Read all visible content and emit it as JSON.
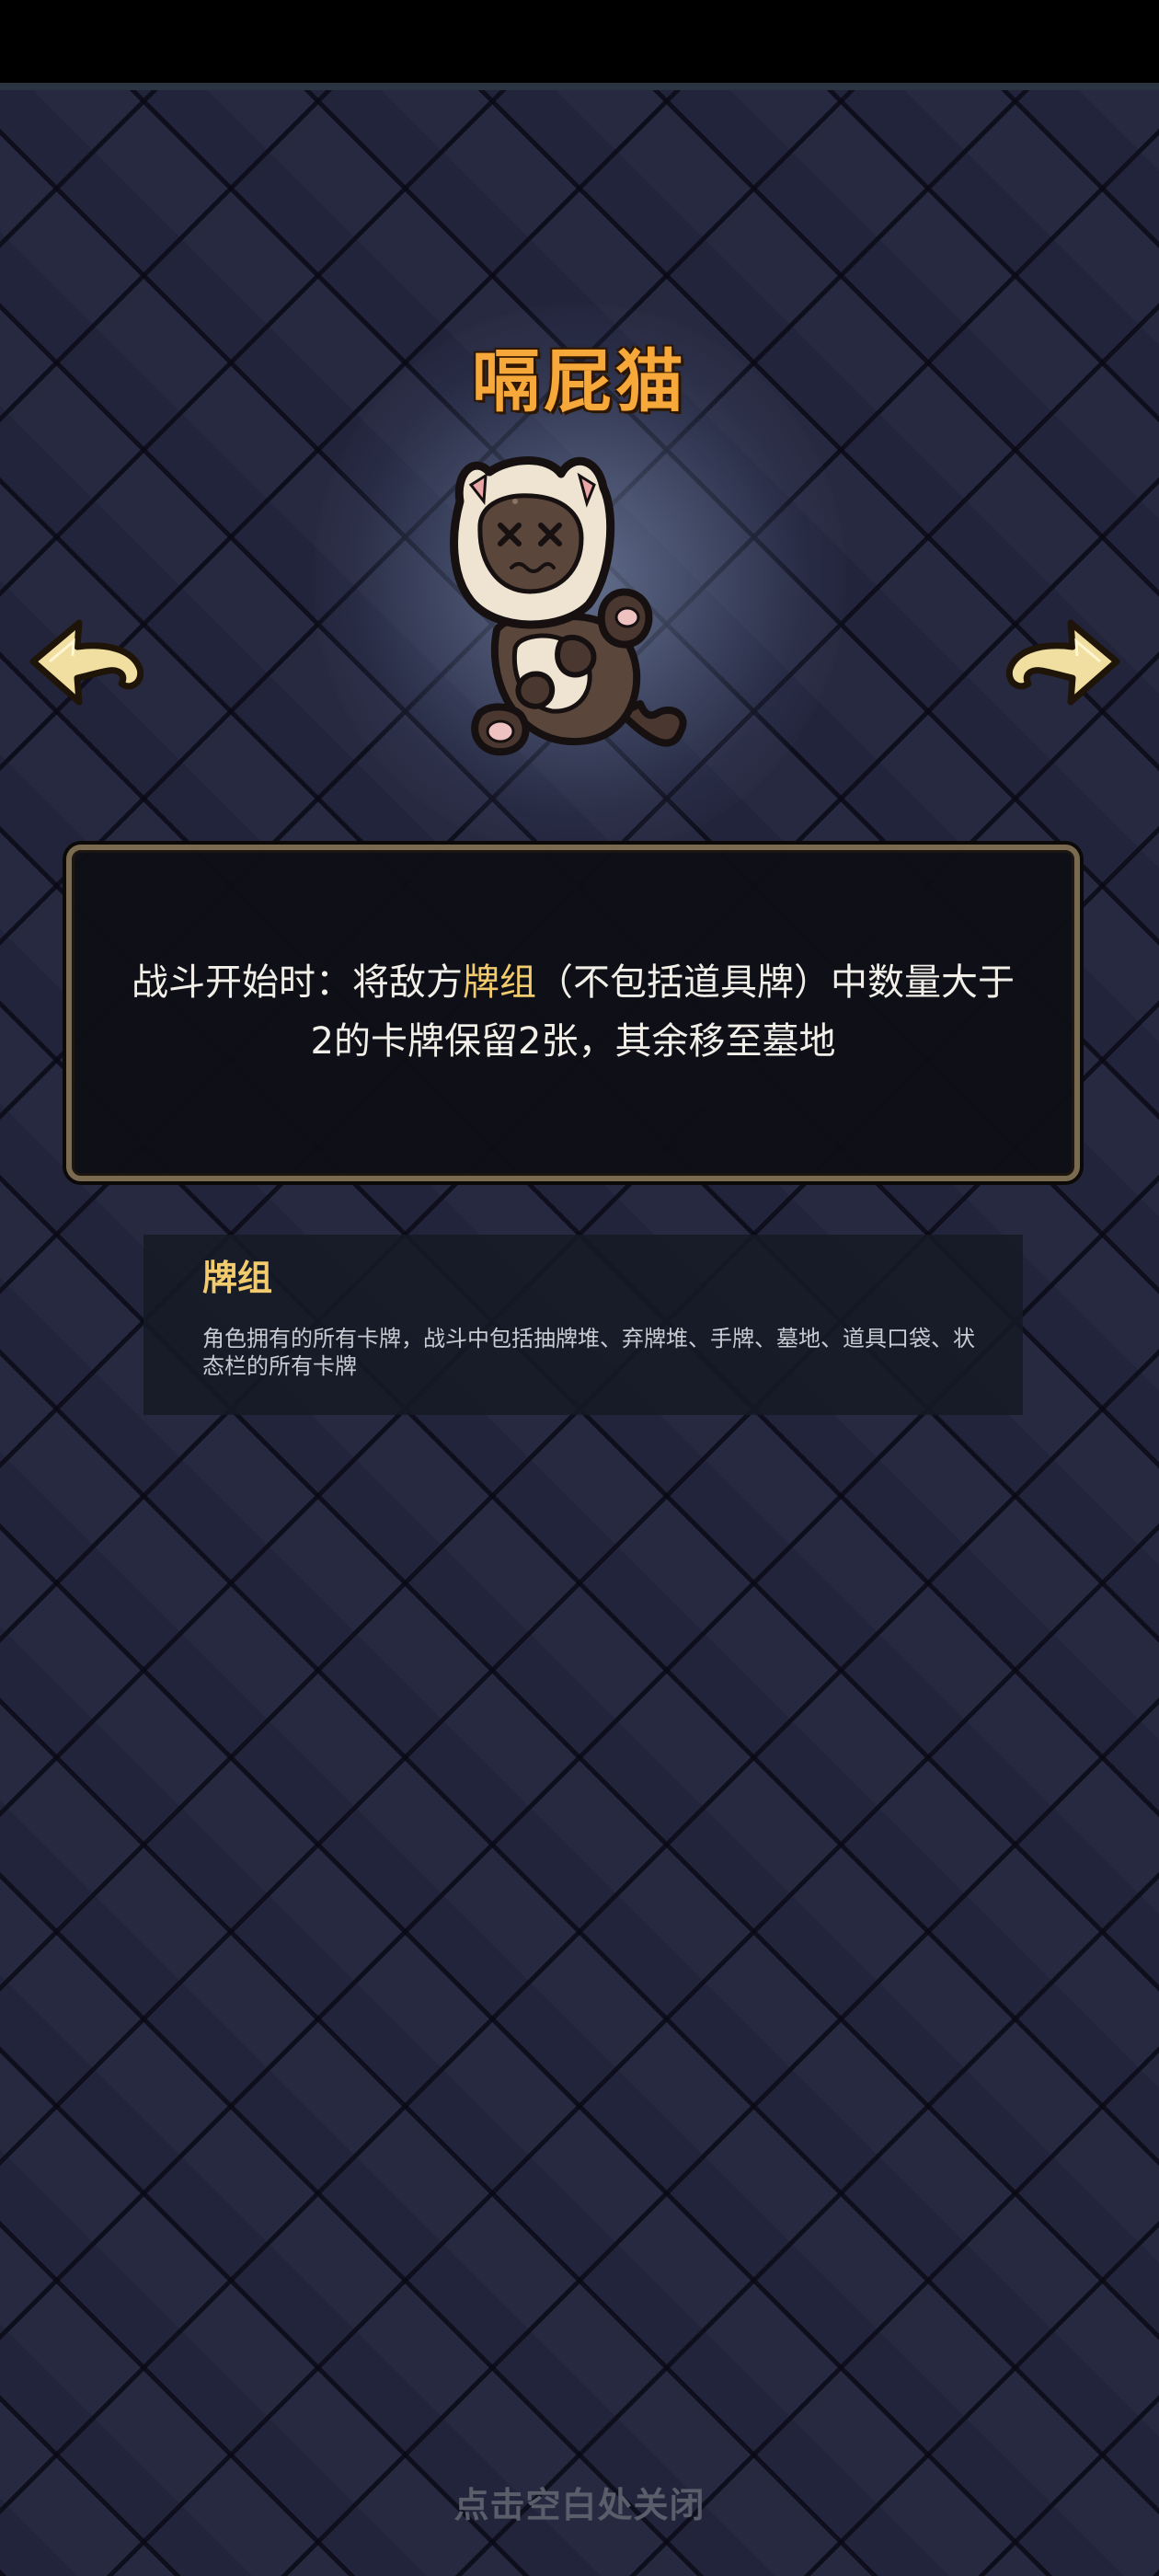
{
  "character": {
    "name": "嗝屁猫",
    "portrait": "dead-siamese-cat-sprite"
  },
  "navigation": {
    "prev_icon": "curled-arrow-left-icon",
    "next_icon": "curled-arrow-right-icon"
  },
  "description": {
    "text_before": "战斗开始时：将敌方",
    "keyword": "牌组",
    "text_after": "（不包括道具牌）中数量大于2的卡牌保留2张，其余移至墓地"
  },
  "glossary": {
    "title": "牌组",
    "text": "角色拥有的所有卡牌，战斗中包括抽牌堆、弃牌堆、手牌、墓地、道具口袋、状态栏的所有卡牌"
  },
  "close_hint": "点击空白处关闭",
  "colors": {
    "title": "#f7a83a",
    "keyword": "#f1cb6d",
    "panel_border": "#7a6a4f",
    "background": "#22243b"
  }
}
